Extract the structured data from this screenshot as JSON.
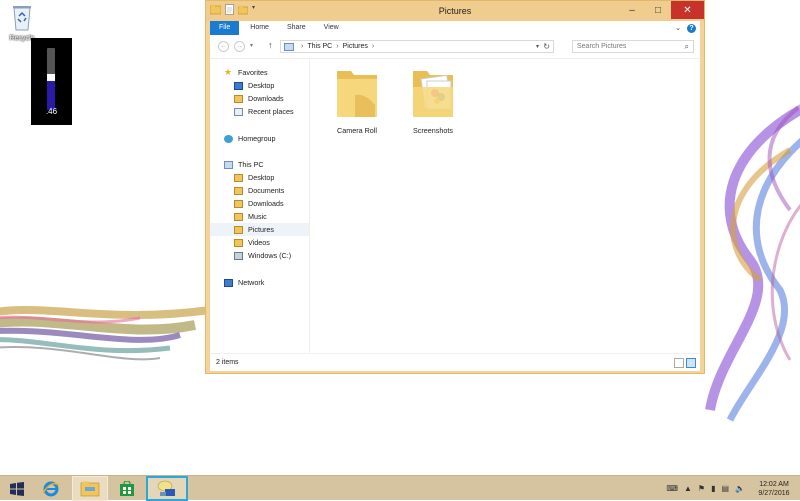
{
  "desktop": {
    "recycle_bin_label": "Recycle",
    "gadget_value": ".46",
    "gadget_level": 0.46
  },
  "window": {
    "title": "Pictures",
    "ribbon_tabs": [
      "File",
      "Home",
      "Share",
      "View"
    ],
    "help_label": "?",
    "address": {
      "segments": [
        "This PC",
        "Pictures"
      ]
    },
    "search_placeholder": "Search Pictures",
    "nav_pane": {
      "favorites": {
        "label": "Favorites",
        "items": [
          "Desktop",
          "Downloads",
          "Recent places"
        ]
      },
      "homegroup": "Homegroup",
      "this_pc": {
        "label": "This PC",
        "items": [
          "Desktop",
          "Documents",
          "Downloads",
          "Music",
          "Pictures",
          "Videos",
          "Windows (C:)"
        ]
      },
      "network": "Network",
      "selected": "Pictures"
    },
    "items": [
      {
        "name": "Camera Roll"
      },
      {
        "name": "Screenshots"
      }
    ],
    "status_text": "2 items"
  },
  "taskbar": {
    "clock_time": "12:02 AM",
    "clock_date": "9/27/2016"
  },
  "colors": {
    "window_frame": "#f0cd8f",
    "file_tab": "#1a7bd1",
    "close_button": "#c7332a",
    "taskbar": "#d6c4a0",
    "gadget_fill": "#2a1aa8"
  }
}
